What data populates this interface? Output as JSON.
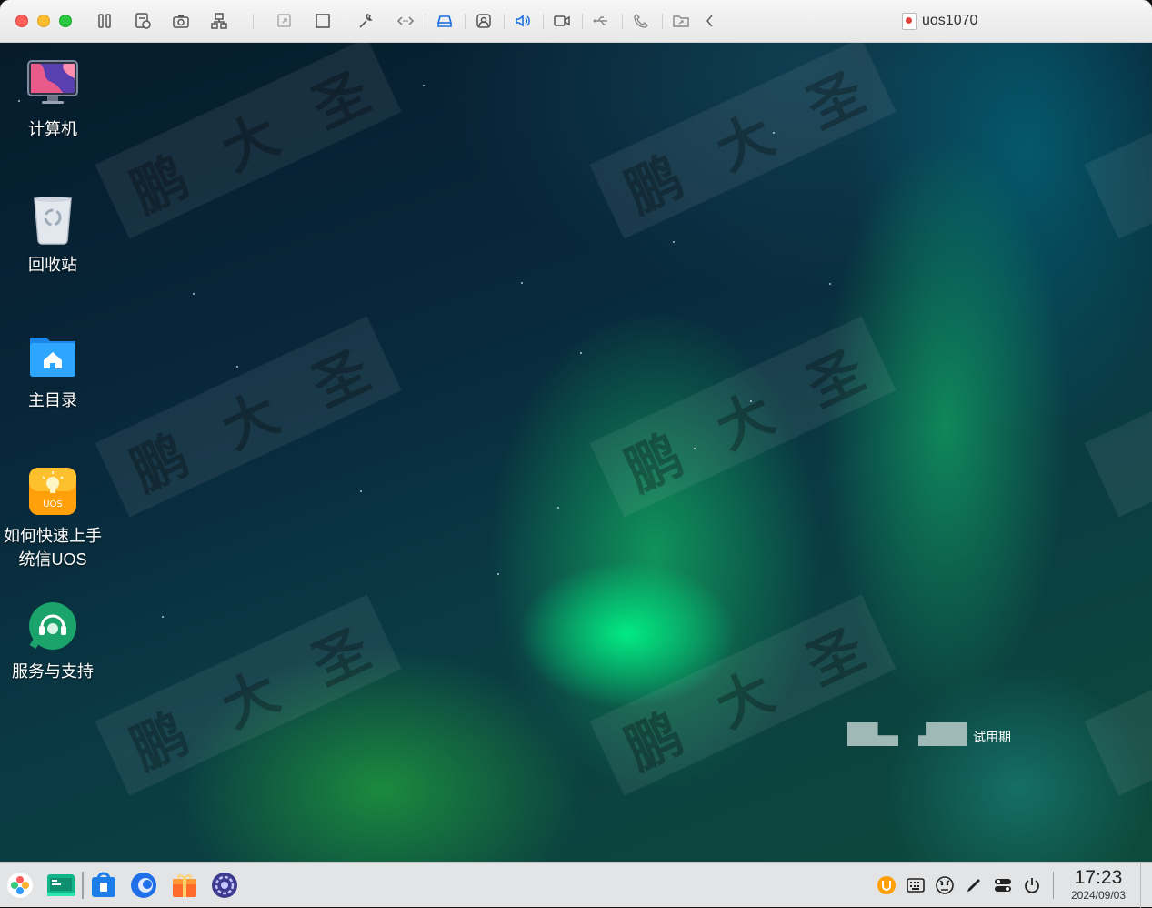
{
  "window": {
    "title": "uos1070"
  },
  "toolbar": {
    "icons": [
      "pause-icon",
      "snapshot-list-icon",
      "camera-icon",
      "network-icon",
      "restore-icon",
      "fullscreen-icon",
      "wrench-icon",
      "code-icon",
      "drive-icon",
      "account-icon",
      "speaker-icon",
      "video-icon",
      "usb-icon",
      "phone-icon",
      "shared-folder-icon",
      "chevron-left-icon"
    ]
  },
  "desktop": {
    "icons": [
      {
        "label": "计算机",
        "icon": "computer-icon"
      },
      {
        "label": "回收站",
        "icon": "trash-icon"
      },
      {
        "label": "主目录",
        "icon": "home-folder-icon"
      },
      {
        "label": "如何快速上手统信UOS",
        "icon": "uos-guide-icon"
      },
      {
        "label": "服务与支持",
        "icon": "support-icon"
      }
    ],
    "watermark": [
      "鹏",
      "大",
      "圣"
    ],
    "activation_label": "试用期"
  },
  "taskbar": {
    "apps": [
      "launcher-icon",
      "file-manager-icon",
      "app-store-icon",
      "browser-icon",
      "gift-icon",
      "settings-icon"
    ],
    "tray": [
      "uos-id-icon",
      "keyboard-icon",
      "user-icon",
      "pen-icon",
      "toggle-icon",
      "power-icon"
    ],
    "time": "17:23",
    "date": "2024/09/03"
  },
  "colors": {
    "accent": "#1a8cff",
    "aurora": "#00e87a",
    "taskbar": "#e2e4e6"
  }
}
